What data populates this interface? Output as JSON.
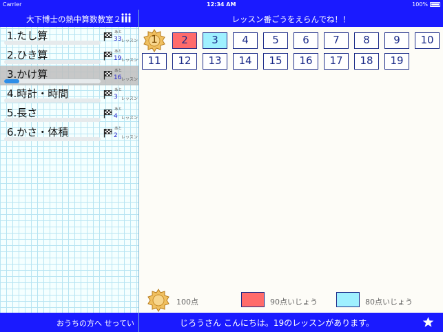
{
  "status_bar": {
    "carrier": "Carrier",
    "time": "12:34 AM",
    "battery": "100%"
  },
  "sidebar": {
    "title": "大下博士の熱中算数教室２",
    "categories": [
      {
        "label": "1.たし算",
        "ato": "あと",
        "count": "33",
        "unit": "レッスン",
        "progress": 0.0
      },
      {
        "label": "2.ひき算",
        "ato": "あと",
        "count": "19",
        "unit": "レッスン",
        "progress": 0.0
      },
      {
        "label": "3.かけ算",
        "ato": "あと",
        "count": "16",
        "unit": "レッスン",
        "progress": 0.16,
        "selected": true
      },
      {
        "label": "4.時計・時間",
        "ato": "あと",
        "count": "3",
        "unit": "レッスン",
        "progress": 0.0
      },
      {
        "label": "5.長さ",
        "ato": "あと",
        "count": "4",
        "unit": "レッスン",
        "progress": 0.0
      },
      {
        "label": "6.かさ・体積",
        "ato": "あと",
        "count": "2",
        "unit": "レッスン",
        "progress": 0.0
      }
    ],
    "footer_link": "おうちの方へ せってい"
  },
  "main": {
    "title": "レッスン番ごうをえらんでね！！",
    "lessons": [
      {
        "num": "1",
        "status": "gold"
      },
      {
        "num": "2",
        "status": "red"
      },
      {
        "num": "3",
        "status": "cyan"
      },
      {
        "num": "4",
        "status": "none"
      },
      {
        "num": "5",
        "status": "none"
      },
      {
        "num": "6",
        "status": "none"
      },
      {
        "num": "7",
        "status": "none"
      },
      {
        "num": "8",
        "status": "none"
      },
      {
        "num": "9",
        "status": "none"
      },
      {
        "num": "10",
        "status": "none"
      },
      {
        "num": "11",
        "status": "none"
      },
      {
        "num": "12",
        "status": "none"
      },
      {
        "num": "13",
        "status": "none"
      },
      {
        "num": "14",
        "status": "none"
      },
      {
        "num": "15",
        "status": "none"
      },
      {
        "num": "16",
        "status": "none"
      },
      {
        "num": "17",
        "status": "none"
      },
      {
        "num": "18",
        "status": "none"
      },
      {
        "num": "19",
        "status": "none"
      }
    ],
    "legend": {
      "gold_label": "100点",
      "red_label": "90点いじょう",
      "cyan_label": "80点いじょう"
    },
    "greeting": "じろうさん こんにちは。19のレッスンがあります。"
  },
  "colors": {
    "header_blue": "#1a1aff",
    "red": "#ff6b6b",
    "cyan": "#9ff0ff",
    "progress_blue": "#2c8ee8",
    "gold": "#e8b44a"
  },
  "icons": {
    "stats": "bar-chart-person-icon",
    "flag": "checkered-flag-icon",
    "medal": "gold-medal-icon",
    "star": "star-icon"
  }
}
